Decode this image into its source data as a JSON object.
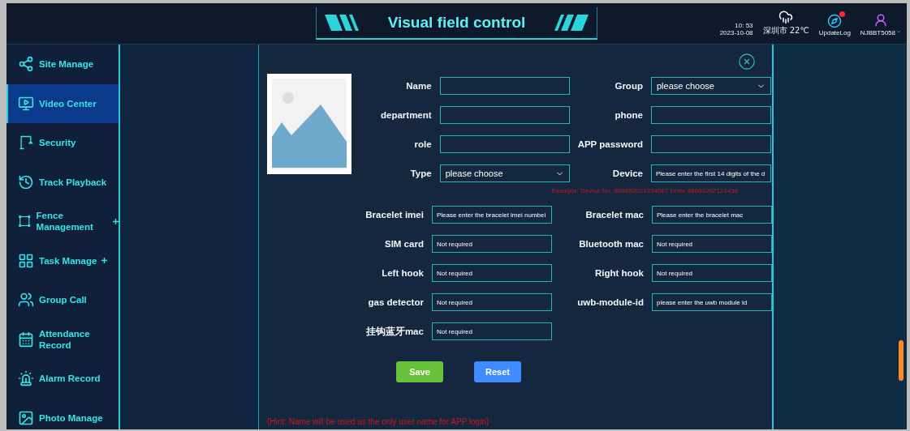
{
  "header": {
    "title": "Visual field control",
    "time": "10: 53",
    "date": "2023-10-08",
    "weather": "深圳市 22℃",
    "update_log": "UpdateLog",
    "update_log_unread": true,
    "user": "NJBBT5058"
  },
  "sidebar": {
    "items": [
      {
        "label": "Site Manage",
        "selected": false,
        "expandable": false
      },
      {
        "label": "Video Center",
        "selected": true,
        "expandable": false
      },
      {
        "label": "Security",
        "selected": false,
        "expandable": false
      },
      {
        "label": "Track Playback",
        "selected": false,
        "expandable": false
      },
      {
        "label": "Fence Management",
        "selected": false,
        "expandable": true
      },
      {
        "label": "Task Manage",
        "selected": false,
        "expandable": true
      },
      {
        "label": "Group Call",
        "selected": false,
        "expandable": false
      },
      {
        "label": "Attendance Record",
        "selected": false,
        "expandable": false
      },
      {
        "label": "Alarm Record",
        "selected": false,
        "expandable": false
      },
      {
        "label": "Photo Manage",
        "selected": false,
        "expandable": false
      }
    ]
  },
  "dialog": {
    "top_rows": [
      [
        {
          "label": "Name",
          "kind": "text"
        },
        {
          "label": "Group",
          "kind": "select",
          "value": "please choose"
        }
      ],
      [
        {
          "label": "department",
          "kind": "text"
        },
        {
          "label": "phone",
          "kind": "text"
        }
      ],
      [
        {
          "label": "role",
          "kind": "text"
        },
        {
          "label": "APP password",
          "kind": "text"
        }
      ],
      [
        {
          "label": "Type",
          "kind": "select",
          "value": "please choose"
        },
        {
          "label": "Device",
          "kind": "text",
          "placeholder": "Please enter the first 14 digits of the d"
        }
      ]
    ],
    "device_example": "Example: Device No. 866652021234567 Enter 86665202123456",
    "rows": [
      [
        {
          "label": "Bracelet imei",
          "kind": "text",
          "placeholder": "Please enter the bracelet imei numbei"
        },
        {
          "label": "Bracelet mac",
          "kind": "text",
          "placeholder": "Please enter the bracelet mac"
        }
      ],
      [
        {
          "label": "SIM card",
          "kind": "text",
          "placeholder": "Not required"
        },
        {
          "label": "Bluetooth mac",
          "kind": "text",
          "placeholder": "Not required"
        }
      ],
      [
        {
          "label": "Left hook",
          "kind": "text",
          "placeholder": "Not required"
        },
        {
          "label": "Right hook",
          "kind": "text",
          "placeholder": "Not required"
        }
      ],
      [
        {
          "label": "gas detector",
          "kind": "text",
          "placeholder": "Not required"
        },
        {
          "label": "uwb-module-id",
          "kind": "text",
          "placeholder": "please enter the uwb module id"
        }
      ],
      [
        {
          "label": "挂钩蓝牙mac",
          "kind": "text",
          "placeholder": "Not required"
        }
      ]
    ],
    "buttons": [
      {
        "label": "Save",
        "kind": "primary"
      },
      {
        "label": "Reset",
        "kind": "secondary"
      }
    ],
    "hint": "(Hint: Name will be used as the only user name for APP login)"
  }
}
